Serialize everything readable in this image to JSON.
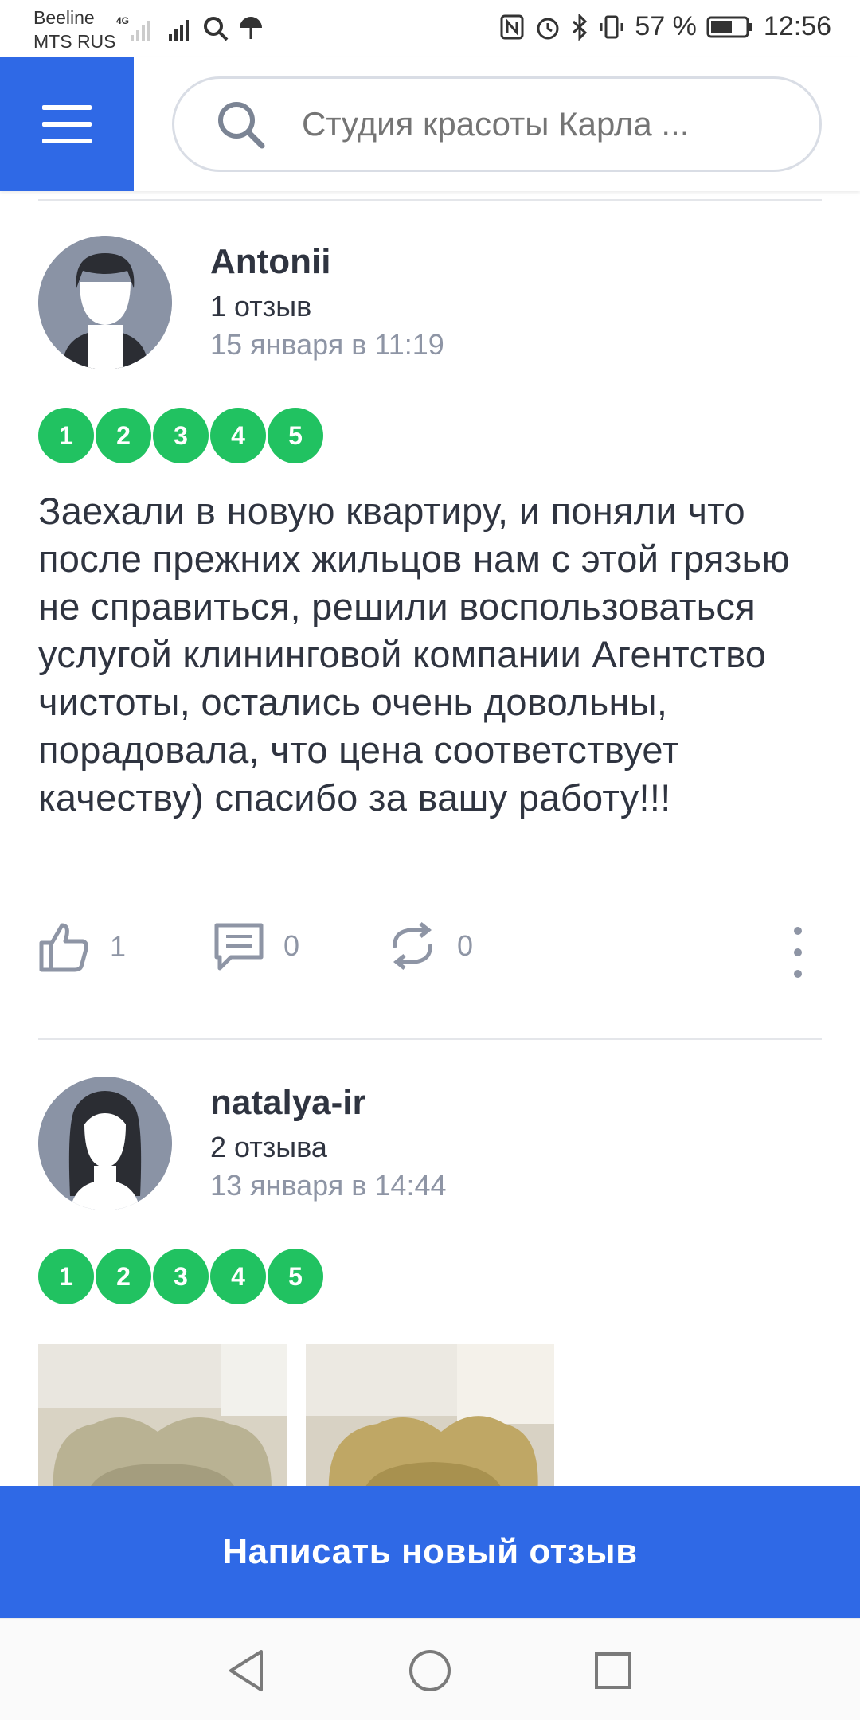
{
  "status_bar": {
    "carrier_1": "Beeline",
    "carrier_2": "MTS RUS",
    "network": "4G",
    "battery": "57 %",
    "time": "12:56"
  },
  "header": {
    "search_placeholder": "Студия красоты Карла ..."
  },
  "reviews": [
    {
      "author": "Antonii",
      "count": "1 отзыв",
      "date": "15 января в 11:19",
      "rating": [
        "1",
        "2",
        "3",
        "4",
        "5"
      ],
      "text": "Заехали в новую квартиру, и поняли что после прежних жильцов нам с этой грязью не справиться, решили воспользоваться услугой клининговой компании Агентство чистоты, остались очень довольны, порадовала, что цена соответствует качеству) спасибо за вашу работу!!!",
      "likes": "1",
      "comments": "0",
      "reposts": "0"
    },
    {
      "author": "natalya-ir",
      "count": "2 отзыва",
      "date": "13 января в 14:44",
      "rating": [
        "1",
        "2",
        "3",
        "4",
        "5"
      ]
    }
  ],
  "cta": {
    "label": "Написать новый отзыв"
  },
  "colors": {
    "brand": "#2f69e6",
    "rating": "#21c261",
    "muted": "#8e95a5"
  }
}
